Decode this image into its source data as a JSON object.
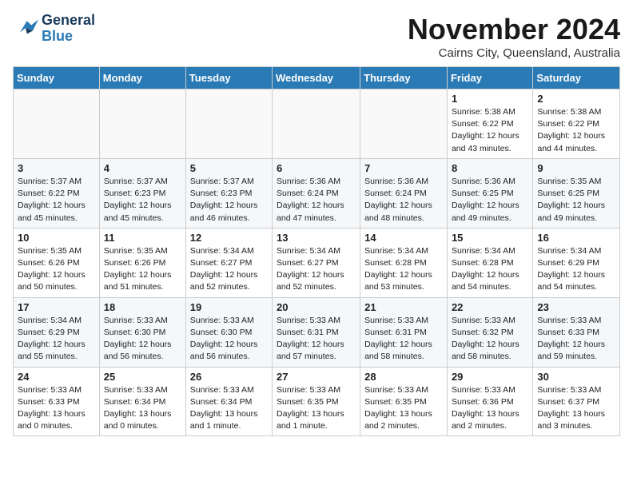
{
  "logo": {
    "line1": "General",
    "line2": "Blue"
  },
  "title": "November 2024",
  "location": "Cairns City, Queensland, Australia",
  "weekdays": [
    "Sunday",
    "Monday",
    "Tuesday",
    "Wednesday",
    "Thursday",
    "Friday",
    "Saturday"
  ],
  "weeks": [
    [
      {
        "day": "",
        "info": ""
      },
      {
        "day": "",
        "info": ""
      },
      {
        "day": "",
        "info": ""
      },
      {
        "day": "",
        "info": ""
      },
      {
        "day": "",
        "info": ""
      },
      {
        "day": "1",
        "info": "Sunrise: 5:38 AM\nSunset: 6:22 PM\nDaylight: 12 hours\nand 43 minutes."
      },
      {
        "day": "2",
        "info": "Sunrise: 5:38 AM\nSunset: 6:22 PM\nDaylight: 12 hours\nand 44 minutes."
      }
    ],
    [
      {
        "day": "3",
        "info": "Sunrise: 5:37 AM\nSunset: 6:22 PM\nDaylight: 12 hours\nand 45 minutes."
      },
      {
        "day": "4",
        "info": "Sunrise: 5:37 AM\nSunset: 6:23 PM\nDaylight: 12 hours\nand 45 minutes."
      },
      {
        "day": "5",
        "info": "Sunrise: 5:37 AM\nSunset: 6:23 PM\nDaylight: 12 hours\nand 46 minutes."
      },
      {
        "day": "6",
        "info": "Sunrise: 5:36 AM\nSunset: 6:24 PM\nDaylight: 12 hours\nand 47 minutes."
      },
      {
        "day": "7",
        "info": "Sunrise: 5:36 AM\nSunset: 6:24 PM\nDaylight: 12 hours\nand 48 minutes."
      },
      {
        "day": "8",
        "info": "Sunrise: 5:36 AM\nSunset: 6:25 PM\nDaylight: 12 hours\nand 49 minutes."
      },
      {
        "day": "9",
        "info": "Sunrise: 5:35 AM\nSunset: 6:25 PM\nDaylight: 12 hours\nand 49 minutes."
      }
    ],
    [
      {
        "day": "10",
        "info": "Sunrise: 5:35 AM\nSunset: 6:26 PM\nDaylight: 12 hours\nand 50 minutes."
      },
      {
        "day": "11",
        "info": "Sunrise: 5:35 AM\nSunset: 6:26 PM\nDaylight: 12 hours\nand 51 minutes."
      },
      {
        "day": "12",
        "info": "Sunrise: 5:34 AM\nSunset: 6:27 PM\nDaylight: 12 hours\nand 52 minutes."
      },
      {
        "day": "13",
        "info": "Sunrise: 5:34 AM\nSunset: 6:27 PM\nDaylight: 12 hours\nand 52 minutes."
      },
      {
        "day": "14",
        "info": "Sunrise: 5:34 AM\nSunset: 6:28 PM\nDaylight: 12 hours\nand 53 minutes."
      },
      {
        "day": "15",
        "info": "Sunrise: 5:34 AM\nSunset: 6:28 PM\nDaylight: 12 hours\nand 54 minutes."
      },
      {
        "day": "16",
        "info": "Sunrise: 5:34 AM\nSunset: 6:29 PM\nDaylight: 12 hours\nand 54 minutes."
      }
    ],
    [
      {
        "day": "17",
        "info": "Sunrise: 5:34 AM\nSunset: 6:29 PM\nDaylight: 12 hours\nand 55 minutes."
      },
      {
        "day": "18",
        "info": "Sunrise: 5:33 AM\nSunset: 6:30 PM\nDaylight: 12 hours\nand 56 minutes."
      },
      {
        "day": "19",
        "info": "Sunrise: 5:33 AM\nSunset: 6:30 PM\nDaylight: 12 hours\nand 56 minutes."
      },
      {
        "day": "20",
        "info": "Sunrise: 5:33 AM\nSunset: 6:31 PM\nDaylight: 12 hours\nand 57 minutes."
      },
      {
        "day": "21",
        "info": "Sunrise: 5:33 AM\nSunset: 6:31 PM\nDaylight: 12 hours\nand 58 minutes."
      },
      {
        "day": "22",
        "info": "Sunrise: 5:33 AM\nSunset: 6:32 PM\nDaylight: 12 hours\nand 58 minutes."
      },
      {
        "day": "23",
        "info": "Sunrise: 5:33 AM\nSunset: 6:33 PM\nDaylight: 12 hours\nand 59 minutes."
      }
    ],
    [
      {
        "day": "24",
        "info": "Sunrise: 5:33 AM\nSunset: 6:33 PM\nDaylight: 13 hours\nand 0 minutes."
      },
      {
        "day": "25",
        "info": "Sunrise: 5:33 AM\nSunset: 6:34 PM\nDaylight: 13 hours\nand 0 minutes."
      },
      {
        "day": "26",
        "info": "Sunrise: 5:33 AM\nSunset: 6:34 PM\nDaylight: 13 hours\nand 1 minute."
      },
      {
        "day": "27",
        "info": "Sunrise: 5:33 AM\nSunset: 6:35 PM\nDaylight: 13 hours\nand 1 minute."
      },
      {
        "day": "28",
        "info": "Sunrise: 5:33 AM\nSunset: 6:35 PM\nDaylight: 13 hours\nand 2 minutes."
      },
      {
        "day": "29",
        "info": "Sunrise: 5:33 AM\nSunset: 6:36 PM\nDaylight: 13 hours\nand 2 minutes."
      },
      {
        "day": "30",
        "info": "Sunrise: 5:33 AM\nSunset: 6:37 PM\nDaylight: 13 hours\nand 3 minutes."
      }
    ]
  ]
}
